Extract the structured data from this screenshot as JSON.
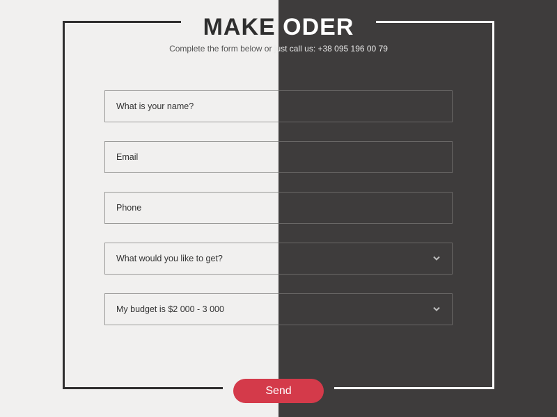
{
  "header": {
    "title_left": "MAKE ",
    "title_right": "ODER",
    "subtitle_left": "Complete the form below or ",
    "subtitle_right": "just call us: +38 095 196 00 79"
  },
  "form": {
    "name": {
      "placeholder": "What is your name?"
    },
    "email": {
      "placeholder": "Email"
    },
    "phone": {
      "placeholder": "Phone"
    },
    "want": {
      "placeholder": "What would you like to get?"
    },
    "budget": {
      "selected": "My budget is $2 000 - 3 000"
    }
  },
  "actions": {
    "send": "Send"
  }
}
